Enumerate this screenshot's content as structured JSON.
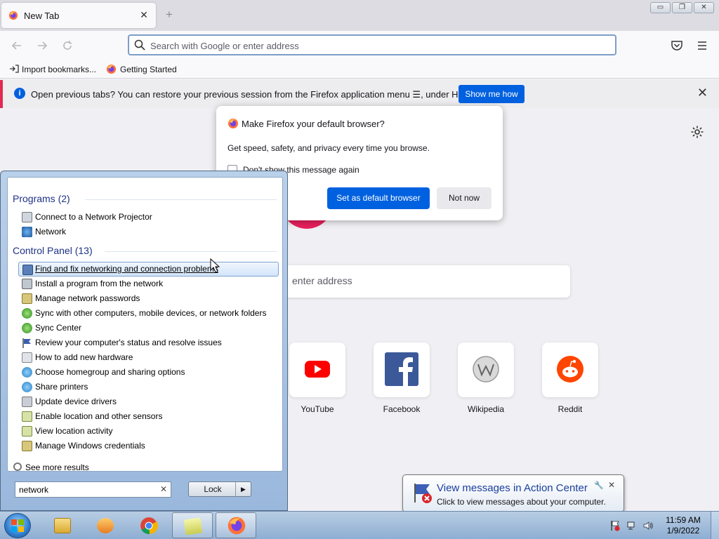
{
  "browser": {
    "tab": {
      "title": "New Tab",
      "close": "✕"
    },
    "new_tab": "+",
    "window_controls": {
      "minimize": "▭",
      "restore": "❐",
      "close": "✕"
    },
    "urlbar": {
      "placeholder": "Search with Google or enter address",
      "value": ""
    },
    "bookmarks": [
      {
        "label": "Import bookmarks...",
        "icon": "import-icon"
      },
      {
        "label": "Getting Started",
        "icon": "firefox-icon"
      }
    ],
    "infobar": {
      "message": "Open previous tabs? You can restore your previous session from the Firefox application menu ☰, under History.",
      "button": "Show me how",
      "close": "✕"
    },
    "newtab_search_placeholder": "enter address",
    "top_sites": [
      {
        "label": "YouTube",
        "color": "#ff0000"
      },
      {
        "label": "Facebook",
        "color": "#1877f2"
      },
      {
        "label": "Wikipedia",
        "color": "#777777"
      },
      {
        "label": "Reddit",
        "color": "#ff4500"
      }
    ],
    "default_dialog": {
      "title": "Make Firefox your default browser?",
      "subtitle": "Get speed, safety, and privacy every time you browse.",
      "checkbox_label": "Don't show this message again",
      "primary_button": "Set as default browser",
      "secondary_button": "Not now"
    }
  },
  "start_menu": {
    "groups": [
      {
        "header": "Programs (2)",
        "items": [
          {
            "label": "Connect to a Network Projector",
            "icon": "projector-icon"
          },
          {
            "label": "Network",
            "icon": "network-icon"
          }
        ]
      },
      {
        "header": "Control Panel (13)",
        "items": [
          {
            "label": "Find and fix networking and connection problems",
            "icon": "troubleshoot-icon",
            "selected": true
          },
          {
            "label": "Install a program from the network",
            "icon": "install-icon"
          },
          {
            "label": "Manage network passwords",
            "icon": "credentials-icon"
          },
          {
            "label": "Sync with other computers, mobile devices, or network folders",
            "icon": "sync-icon"
          },
          {
            "label": "Sync Center",
            "icon": "sync-icon"
          },
          {
            "label": "Review your computer's status and resolve issues",
            "icon": "action-center-flag-icon"
          },
          {
            "label": "How to add new hardware",
            "icon": "hardware-icon"
          },
          {
            "label": "Choose homegroup and sharing options",
            "icon": "homegroup-icon"
          },
          {
            "label": "Share printers",
            "icon": "homegroup-icon"
          },
          {
            "label": "Update device drivers",
            "icon": "device-icon"
          },
          {
            "label": "Enable location and other sensors",
            "icon": "sensor-icon"
          },
          {
            "label": "View location activity",
            "icon": "sensor-icon"
          },
          {
            "label": "Manage Windows credentials",
            "icon": "credentials-icon"
          }
        ]
      }
    ],
    "see_more": "See more results",
    "search_value": "network",
    "search_clear": "✕",
    "lock_button": "Lock",
    "lock_arrow": "▶"
  },
  "balloon": {
    "title": "View messages in Action Center",
    "text": "Click to view messages about your computer.",
    "close": "✕"
  },
  "taskbar": {
    "buttons": [
      {
        "name": "explorer",
        "color": "#e8c25a"
      },
      {
        "name": "media-player",
        "color": "#f0a030"
      },
      {
        "name": "chrome",
        "color": "#4285f4"
      },
      {
        "name": "sticky-notes",
        "color": "#e6e87a"
      },
      {
        "name": "firefox",
        "color": "#ff7139"
      }
    ],
    "clock_time": "11:59 AM",
    "clock_date": "1/9/2022"
  },
  "colors": {
    "accent": "#0061e0",
    "infobar_stripe": "#e22850",
    "win7_link": "#1e3287"
  }
}
